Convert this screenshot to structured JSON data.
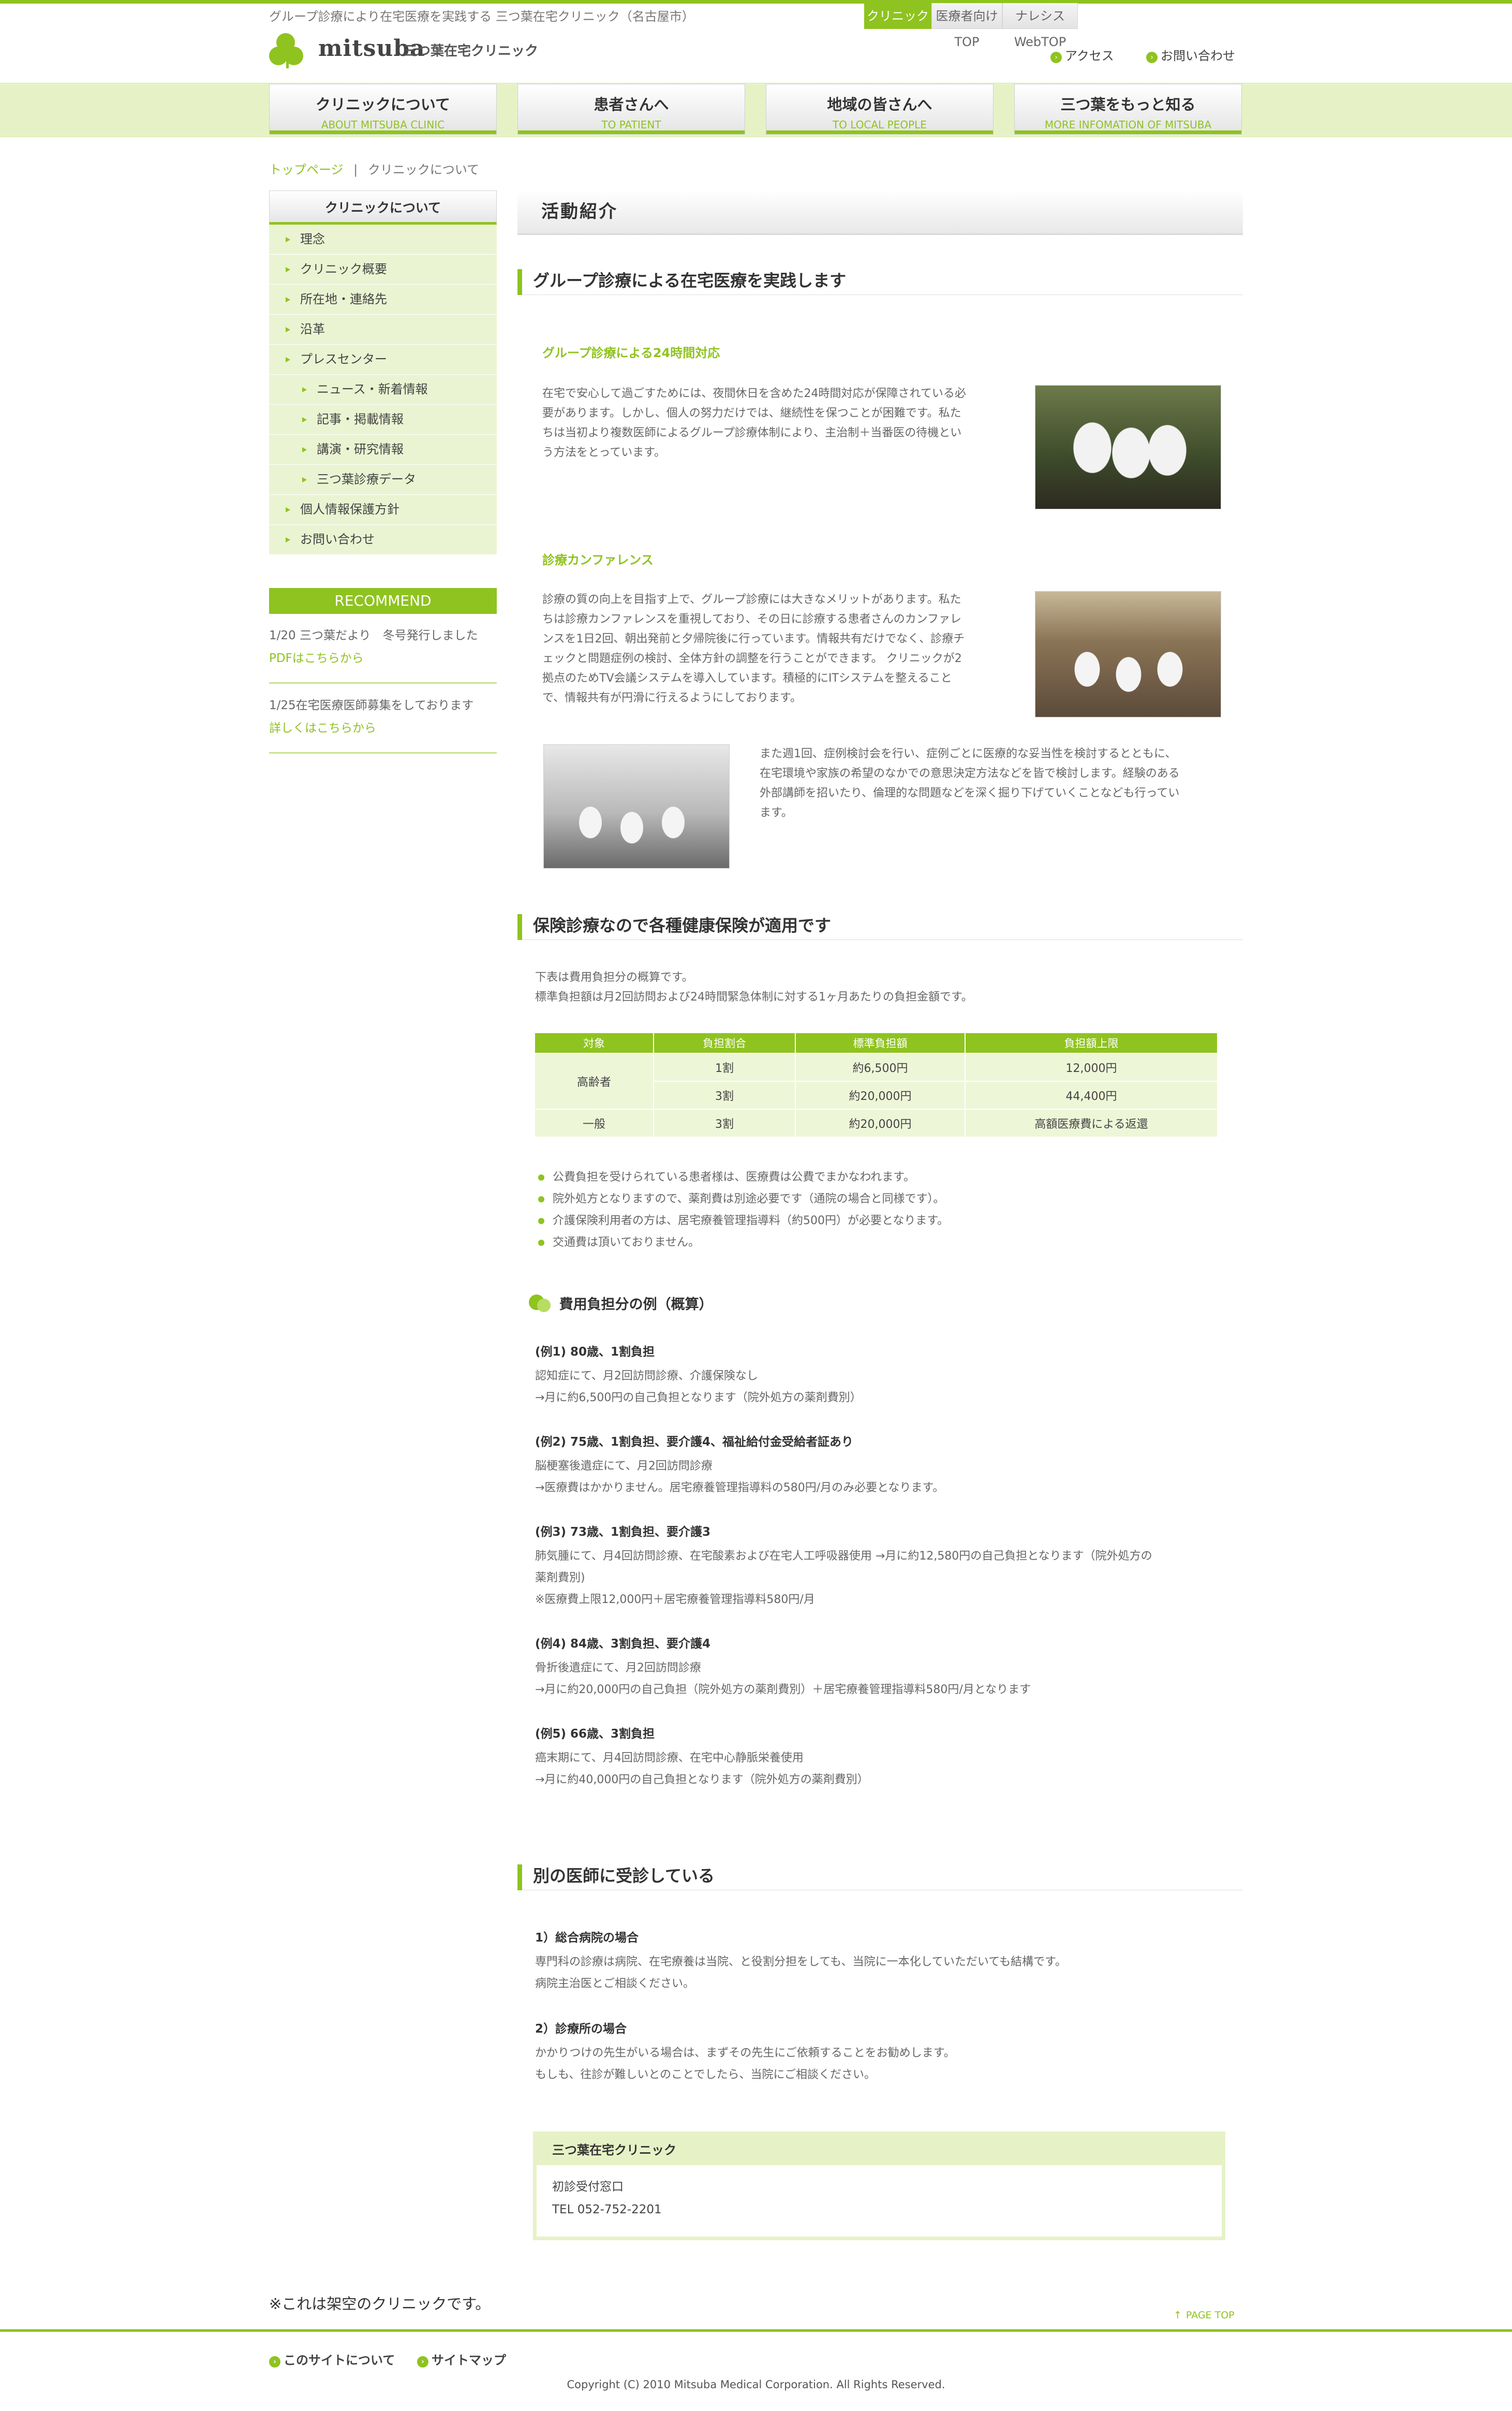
{
  "header": {
    "tagline": "グループ診療により在宅医療を実践する 三つ葉在宅クリニック（名古屋市）",
    "tabs": [
      "クリニックTOP",
      "医療者向けTOP",
      "ナレシスWebTOP"
    ],
    "logo_word": "mitsuba",
    "logo_sub": "三つ葉在宅クリニック",
    "links": [
      "アクセス",
      "お問い合わせ"
    ]
  },
  "nav": [
    {
      "jp": "クリニックについて",
      "en": "ABOUT MITSUBA CLINIC"
    },
    {
      "jp": "患者さんへ",
      "en": "TO PATIENT"
    },
    {
      "jp": "地域の皆さんへ",
      "en": "TO LOCAL PEOPLE"
    },
    {
      "jp": "三つ葉をもっと知る",
      "en": "MORE INFOMATION OF MITSUBA"
    }
  ],
  "breadcrumb": {
    "home": "トップページ",
    "sep": "|",
    "current": "クリニックについて"
  },
  "sidebar": {
    "heading": "クリニックについて",
    "items": [
      "理念",
      "クリニック概要",
      "所在地・連絡先",
      "沿革",
      "プレスセンター",
      "ニュース・新着情報",
      "記事・掲載情報",
      "講演・研究情報",
      "三つ葉診療データ",
      "個人情報保護方針",
      "お問い合わせ"
    ],
    "recommend_title": "RECOMMEND",
    "recommend": [
      {
        "text": "1/20 三つ葉だより　冬号発行しました",
        "link": "PDFはこちらから"
      },
      {
        "text": "1/25在宅医療医師募集をしております",
        "link": "詳しくはこちらから"
      }
    ]
  },
  "main": {
    "page_title": "活動紹介",
    "sec1": {
      "title": "グループ診療による在宅医療を実践します",
      "sub1": "グループ診療による24時間対応",
      "p1": [
        "在宅で安心して過ごすためには、夜間休日を含めた24時間対応が保障されている必",
        "要があります。しかし、個人の努力だけでは、継続性を保つことが困難です。私た",
        "ちは当初より複数医師によるグループ診療体制により、主治制＋当番医の待機とい",
        "う方法をとっています。"
      ],
      "sub2": "診療カンファレンス",
      "p2": [
        "診療の質の向上を目指す上で、グループ診療には大きなメリットがあります。私た",
        "ちは診療カンファレンスを重視しており、その日に診療する患者さんのカンファレ",
        "ンスを1日2回、朝出発前と夕帰院後に行っています。情報共有だけでなく、診療チ",
        "ェックと問題症例の検討、全体方針の調整を行うことができます。 クリニックが2",
        "拠点のためTV会議システムを導入しています。積極的にITシステムを整えること",
        "で、情報共有が円滑に行えるようにしております。"
      ],
      "p3": [
        "また週1回、症例検討会を行い、症例ごとに医療的な妥当性を検討するとともに、",
        "在宅環境や家族の希望のなかでの意思決定方法などを皆で検討します。経験のある",
        "外部講師を招いたり、倫理的な問題などを深く掘り下げていくことなども行ってい",
        "ます。"
      ]
    },
    "sec2": {
      "title": "保険診療なので各種健康保険が適用です",
      "intro": [
        "下表は費用負担分の概算です。",
        "標準負担額は月2回訪問および24時間緊急体制に対する1ヶ月あたりの負担金額です。"
      ],
      "table": {
        "headers": [
          "対象",
          "負担割合",
          "標準負担額",
          "負担額上限"
        ],
        "rows": [
          [
            "高齢者",
            "1割",
            "約6,500円",
            "12,000円"
          ],
          [
            "",
            "3割",
            "約20,000円",
            "44,400円"
          ],
          [
            "一般",
            "3割",
            "約20,000円",
            "高額医療費による返還"
          ]
        ]
      },
      "bullets": [
        "公費負担を受けられている患者様は、医療費は公費でまかなわれます。",
        "院外処方となりますので、薬剤費は別途必要です（通院の場合と同様です）。",
        "介護保険利用者の方は、居宅療養管理指導料（約500円）が必要となります。",
        "交通費は頂いておりません。"
      ],
      "examples_title": "費用負担分の例（概算）",
      "examples": [
        {
          "h": "(例1) 80歳、1割負担",
          "lines": [
            "認知症にて、月2回訪問診療、介護保険なし",
            "→月に約6,500円の自己負担となります（院外処方の薬剤費別）"
          ]
        },
        {
          "h": "(例2) 75歳、1割負担、要介護4、福祉給付金受給者証あり",
          "lines": [
            "脳梗塞後遺症にて、月2回訪問診療",
            "→医療費はかかりません。居宅療養管理指導料の580円/月のみ必要となります。"
          ]
        },
        {
          "h": "(例3) 73歳、1割負担、要介護3",
          "lines": [
            "肺気腫にて、月4回訪問診療、在宅酸素および在宅人工呼吸器使用 →月に約12,580円の自己負担となります（院外処方の",
            "薬剤費別)",
            "※医療費上限12,000円＋居宅療養管理指導料580円/月"
          ]
        },
        {
          "h": "(例4) 84歳、3割負担、要介護4",
          "lines": [
            "骨折後遺症にて、月2回訪問診療",
            "→月に約20,000円の自己負担（院外処方の薬剤費別）＋居宅療養管理指導料580円/月となります"
          ]
        },
        {
          "h": "(例5) 66歳、3割負担",
          "lines": [
            "癌末期にて、月4回訪問診療、在宅中心静脈栄養使用",
            "→月に約40,000円の自己負担となります（院外処方の薬剤費別）"
          ]
        }
      ]
    },
    "sec3": {
      "title": "別の医師に受診している",
      "items": [
        {
          "h": "1）総合病院の場合",
          "lines": [
            "専門科の診療は病院、在宅療養は当院、と役割分担をしても、当院に一本化していただいても結構です。",
            "病院主治医とご相談ください。"
          ]
        },
        {
          "h": "2）診療所の場合",
          "lines": [
            "かかりつけの先生がいる場合は、まずその先生にご依頼することをお勧めします。",
            "もしも、往診が難しいとのことでしたら、当院にご相談ください。"
          ]
        }
      ]
    },
    "infobox": {
      "title": "三つ葉在宅クリニック",
      "lines": [
        "初診受付窓口",
        "TEL 052-752-2201"
      ]
    }
  },
  "footer": {
    "note": "※これは架空のクリニックです。",
    "pagetop": "PAGE TOP",
    "links": [
      "このサイトについて",
      "サイトマップ"
    ],
    "copyright": "Copyright (C) 2010 Mitsuba Medical Corporation. All Rights Reserved."
  },
  "colors": {
    "accent": "#8fc31f",
    "light": "#e6f2c6"
  }
}
